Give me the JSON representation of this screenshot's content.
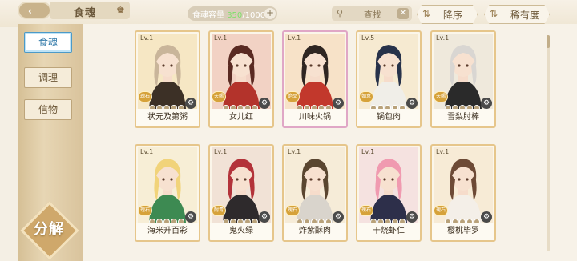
{
  "header": {
    "title": "食魂",
    "capacity_label": "食魂容量 ",
    "capacity_current": "350",
    "capacity_max": "/1000",
    "capacity_add": "+",
    "search_placeholder": "查找",
    "sort_order_label": "降序",
    "sort_by_label": "稀有度"
  },
  "sidebar": {
    "tabs": [
      {
        "label": "食魂",
        "active": true
      },
      {
        "label": "调理",
        "active": false
      },
      {
        "label": "信物",
        "active": false
      }
    ],
    "decompose_label": "分解"
  },
  "cards": [
    {
      "name": "状元及第粥",
      "level": "Lv.1",
      "rarity": "瑰石",
      "stars_on": 0,
      "hair": "#c9b59a",
      "outfit": "#3c3026",
      "bg": "#f6e7c4",
      "frame": "gold"
    },
    {
      "name": "女儿红",
      "level": "Lv.1",
      "rarity": "天赐",
      "stars_on": 0,
      "hair": "#5a2a22",
      "outfit": "#b3332b",
      "bg": "#f2d2c4",
      "frame": "gold"
    },
    {
      "name": "川味火锅",
      "level": "Lv.1",
      "rarity": "绝品",
      "stars_on": 0,
      "hair": "#2f2622",
      "outfit": "#c2382c",
      "bg": "#f7e2c8",
      "frame": "rare"
    },
    {
      "name": "锅包肉",
      "level": "Lv.5",
      "rarity": "如意",
      "stars_on": 0,
      "hair": "#27324a",
      "outfit": "#f0eee8",
      "bg": "#f6ead1",
      "frame": "gold"
    },
    {
      "name": "雪梨肘棒",
      "level": "Lv.1",
      "rarity": "天赐",
      "stars_on": 0,
      "hair": "#d9d6d2",
      "outfit": "#2a2a2a",
      "bg": "#efe9dc",
      "frame": "gold"
    },
    {
      "name": "海米升百彩",
      "level": "Lv.1",
      "rarity": "瑰石",
      "stars_on": 0,
      "hair": "#f1d37a",
      "outfit": "#3d8a52",
      "bg": "#f7eed6",
      "frame": "gold"
    },
    {
      "name": "鬼火绿",
      "level": "Lv.1",
      "rarity": "耐青",
      "stars_on": 0,
      "hair": "#b3333a",
      "outfit": "#2e2a2c",
      "bg": "#f1e2d6",
      "frame": "gold"
    },
    {
      "name": "炸紫酥肉",
      "level": "Lv.1",
      "rarity": "瑰石",
      "stars_on": 0,
      "hair": "#5a4630",
      "outfit": "#d9d4cc",
      "bg": "#f6ecd8",
      "frame": "gold"
    },
    {
      "name": "干烧虾仁",
      "level": "Lv.1",
      "rarity": "瑰石",
      "stars_on": 0,
      "hair": "#f09ab0",
      "outfit": "#2d2f4a",
      "bg": "#f5e2e0",
      "frame": "gold"
    },
    {
      "name": "樱桃毕罗",
      "level": "Lv.1",
      "rarity": "瑰石",
      "stars_on": 0,
      "hair": "#6d4a36",
      "outfit": "#f4efe8",
      "bg": "#f7ebd6",
      "frame": "gold"
    }
  ]
}
